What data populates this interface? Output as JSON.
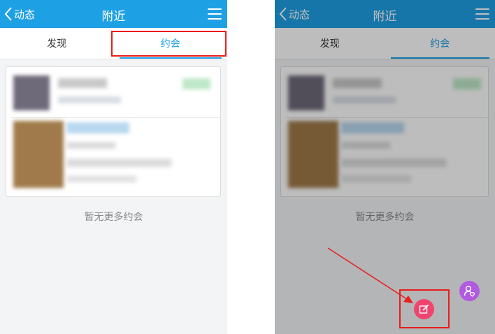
{
  "header": {
    "back_label": "动态",
    "title": "附近"
  },
  "tabs": [
    {
      "label": "发现"
    },
    {
      "label": "约会"
    }
  ],
  "empty_text": "暂无更多约会",
  "colors": {
    "topbar": "#1ea0e5",
    "tab_active": "#1ea0e5",
    "highlight": "#e81d1d",
    "compose_button": "#f0446e",
    "friends_button": "#b15be0"
  },
  "icons": [
    "chevron-left-icon",
    "menu-icon",
    "compose-icon",
    "friends-icon"
  ]
}
